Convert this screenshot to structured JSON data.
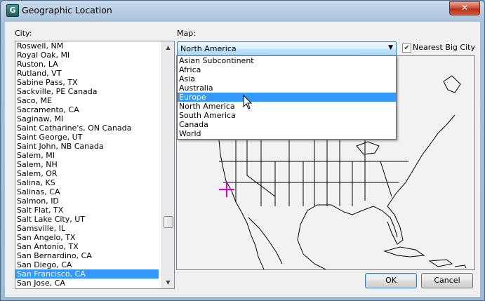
{
  "window": {
    "title": "Geographic Location",
    "app_icon_letter": "G",
    "close_glyph": "✕"
  },
  "city": {
    "label": "City:",
    "items": [
      "Roswell, NM",
      "Royal Oak, MI",
      "Ruston, LA",
      "Rutland, VT",
      "Sabine Pass, TX",
      "Sackville, PE Canada",
      "Saco, ME",
      "Sacramento, CA",
      "Saginaw, MI",
      "Saint Catharine's, ON Canada",
      "Saint George, UT",
      "Saint John, NB Canada",
      "Salem, MI",
      "Salem, NH",
      "Salem, OR",
      "Salina, KS",
      "Salinas, CA",
      "Salmon, ID",
      "Salt Flat, TX",
      "Salt Lake City, UT",
      "Samsville, IL",
      "San Angelo, TX",
      "San Antonio, TX",
      "San Bernardino, CA",
      "San Diego, CA",
      "San Francisco, CA",
      "San Jose, CA"
    ],
    "selected": "San Francisco, CA",
    "scroll_up": "▲",
    "scroll_down": "▼"
  },
  "map": {
    "label": "Map:",
    "selected": "North America",
    "arrow": "▼",
    "options": [
      "Asian Subcontinent",
      "Africa",
      "Asia",
      "Australia",
      "Europe",
      "North America",
      "South America",
      "Canada",
      "World"
    ],
    "hovered": "Europe",
    "marker_color": "#e000c8"
  },
  "nearest_big_city": {
    "label": "Nearest Big City",
    "checked": true,
    "check_glyph": "✔"
  },
  "buttons": {
    "ok": "OK",
    "cancel": "Cancel"
  }
}
